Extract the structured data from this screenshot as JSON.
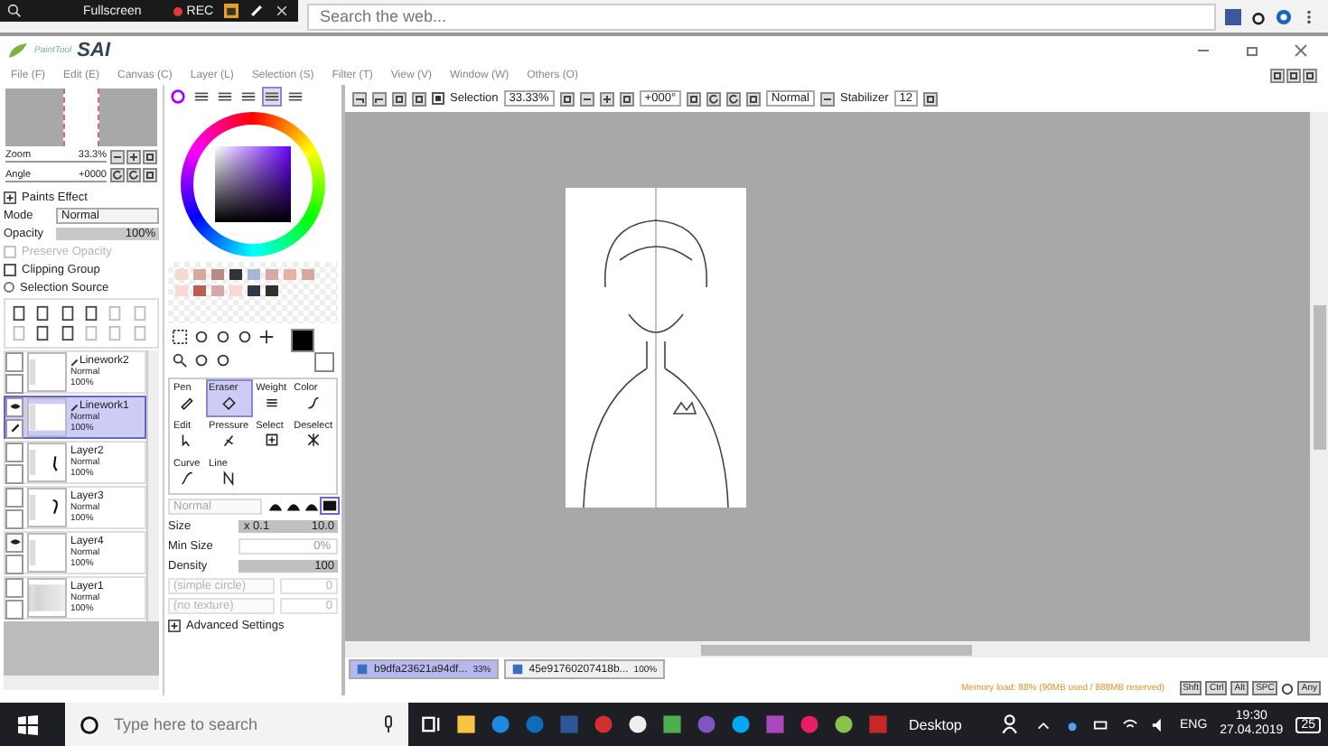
{
  "recorder": {
    "label": "Fullscreen",
    "rec": "REC"
  },
  "browser": {
    "search_placeholder": "Search the web..."
  },
  "app": {
    "brand": "PaintTool",
    "title": "SAI"
  },
  "menu": [
    "File (F)",
    "Edit (E)",
    "Canvas (C)",
    "Layer (L)",
    "Selection (S)",
    "Filter (T)",
    "View (V)",
    "Window (W)",
    "Others (O)"
  ],
  "toolbar": {
    "selection_label": "Selection",
    "selection_checked": true,
    "zoom": "33.33%",
    "angle": "+000°",
    "blend": "Normal",
    "stabilizer_label": "Stabilizer",
    "stabilizer": "12"
  },
  "navigator": {
    "zoom_label": "Zoom",
    "zoom": "33.3%",
    "angle_label": "Angle",
    "angle": "+0000"
  },
  "layer_panel": {
    "paints_effect": "Paints Effect",
    "mode_label": "Mode",
    "mode": "Normal",
    "opacity_label": "Opacity",
    "opacity": "100%",
    "opacity_slider": {
      "level": 1
    }
  },
  "layer_options": [
    {
      "label": "Preserve Opacity",
      "kind": "checkbox",
      "checked": false,
      "disabled": true
    },
    {
      "label": "Clipping Group",
      "kind": "checkbox",
      "checked": false,
      "disabled": false
    },
    {
      "label": "Selection Source",
      "kind": "radio",
      "checked": false,
      "disabled": false
    }
  ],
  "layers": [
    {
      "name": "Linework2",
      "mode": "Normal",
      "opacity": "100%",
      "kind": "linework",
      "visible": false,
      "selected": false
    },
    {
      "name": "Linework1",
      "mode": "Normal",
      "opacity": "100%",
      "kind": "linework",
      "visible": true,
      "selected": true
    },
    {
      "name": "Layer2",
      "mode": "Normal",
      "opacity": "100%",
      "kind": "stroke",
      "visible": false,
      "selected": false
    },
    {
      "name": "Layer3",
      "mode": "Normal",
      "opacity": "100%",
      "kind": "blot",
      "visible": false,
      "selected": false
    },
    {
      "name": "Layer4",
      "mode": "Normal",
      "opacity": "100%",
      "kind": "blank",
      "visible": true,
      "selected": false
    },
    {
      "name": "Layer1",
      "mode": "Normal",
      "opacity": "100%",
      "kind": "shaded",
      "visible": false,
      "selected": false
    }
  ],
  "swatches": [
    {
      "color": "#f6d8d0"
    },
    {
      "color": "#d7a89c"
    },
    {
      "color": "#b88a80"
    },
    {
      "color": "#333333"
    },
    {
      "color": "#a8b4d8"
    },
    {
      "color": "#d8a8a8"
    },
    {
      "color": "#e8b0a0"
    },
    {
      "color": "#d8a8a0"
    },
    {
      "color": "#f8d8d0"
    },
    {
      "color": "#b86050"
    },
    {
      "color": "#d8a8a8"
    },
    {
      "color": "#f8d8d0"
    },
    {
      "color": "#303848"
    },
    {
      "color": "#303030"
    }
  ],
  "current_colors": [
    {
      "color": "#000000"
    },
    {
      "color": "#ffffff"
    }
  ],
  "tools": [
    {
      "label": "Pen",
      "kind": "pen",
      "selected": false
    },
    {
      "label": "Eraser",
      "kind": "eraser",
      "selected": true
    },
    {
      "label": "Weight",
      "kind": "weight",
      "selected": false
    },
    {
      "label": "Color",
      "kind": "color",
      "selected": false
    },
    {
      "label": "Edit",
      "kind": "edit",
      "selected": false
    },
    {
      "label": "Pressure",
      "kind": "pressure",
      "selected": false
    },
    {
      "label": "Select",
      "kind": "select",
      "selected": false
    },
    {
      "label": "Deselect",
      "kind": "deselect",
      "selected": false
    },
    {
      "label": "Curve",
      "kind": "curve",
      "selected": false
    },
    {
      "label": "Line",
      "kind": "line",
      "selected": false
    }
  ],
  "brush": {
    "blend": "Normal",
    "sliders": [
      {
        "label": "Size",
        "multiplier": "x 0.1",
        "value": "10.0",
        "level": 1
      },
      {
        "label": "Min Size",
        "value": "0%"
      },
      {
        "label": "Density",
        "value": "100",
        "level": 1
      }
    ],
    "shape": "(simple circle)",
    "shape_value": "0",
    "texture": "(no texture)",
    "texture_value": "0",
    "advanced": "Advanced Settings"
  },
  "documents": [
    {
      "name": "b9dfa23621a94df...",
      "zoom": "33%",
      "selected": true
    },
    {
      "name": "45e91760207418b...",
      "zoom": "100%",
      "selected": false
    }
  ],
  "status": {
    "memory": "Memory load: 88% (90MB used / 888MB reserved)",
    "keys": [
      "Shft",
      "Ctrl",
      "Alt",
      "SPC",
      "Any"
    ]
  },
  "taskbar": {
    "search_placeholder": "Type here to search",
    "desktop": "Desktop",
    "language": "ENG",
    "time": "19:30",
    "date": "27.04.2019",
    "notifications": "25"
  }
}
